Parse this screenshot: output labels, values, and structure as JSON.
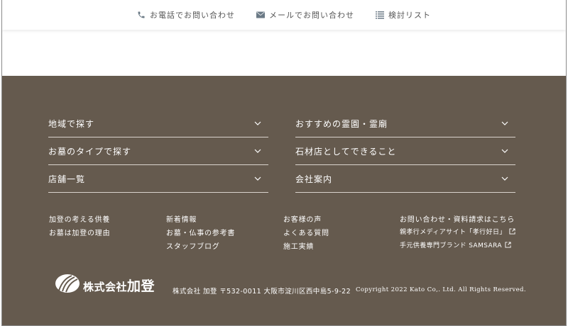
{
  "topbar": {
    "phone_label": "お電話でお問い合わせ",
    "mail_label": "メールでお問い合わせ",
    "list_label": "検討リスト"
  },
  "footer": {
    "accordion_left": [
      {
        "label": "地域で探す"
      },
      {
        "label": "お墓のタイプで探す"
      },
      {
        "label": "店舗一覧"
      }
    ],
    "accordion_right": [
      {
        "label": "おすすめの霊園・霊廟"
      },
      {
        "label": "石材店としてできること"
      },
      {
        "label": "会社案内"
      }
    ],
    "links_col1": [
      "加登の考える供養",
      "お墓は加登の理由"
    ],
    "links_col2": [
      "新着情報",
      "お墓・仏事の参考書",
      "スタッフブログ"
    ],
    "links_col3": [
      "お客様の声",
      "よくある質問",
      "施工実績"
    ],
    "links_col4": {
      "contact": "お問い合わせ・資料請求はこちら",
      "external": [
        "親孝行メディアサイト「孝行好日」",
        "手元供養専門ブランド SAMSARA"
      ]
    },
    "logo": {
      "prefix": "株式会社",
      "name": "加登"
    },
    "address": "株式会社 加登 〒532-0011 大阪市淀川区西中島5-9-22",
    "copyright": "Copyright 2022 Kato Co,. Ltd. All Rights Reserved."
  },
  "colors": {
    "footer_bg": "#655a4e",
    "divider": "#d9d3cc",
    "topbar_icon": "#6b7a86"
  }
}
